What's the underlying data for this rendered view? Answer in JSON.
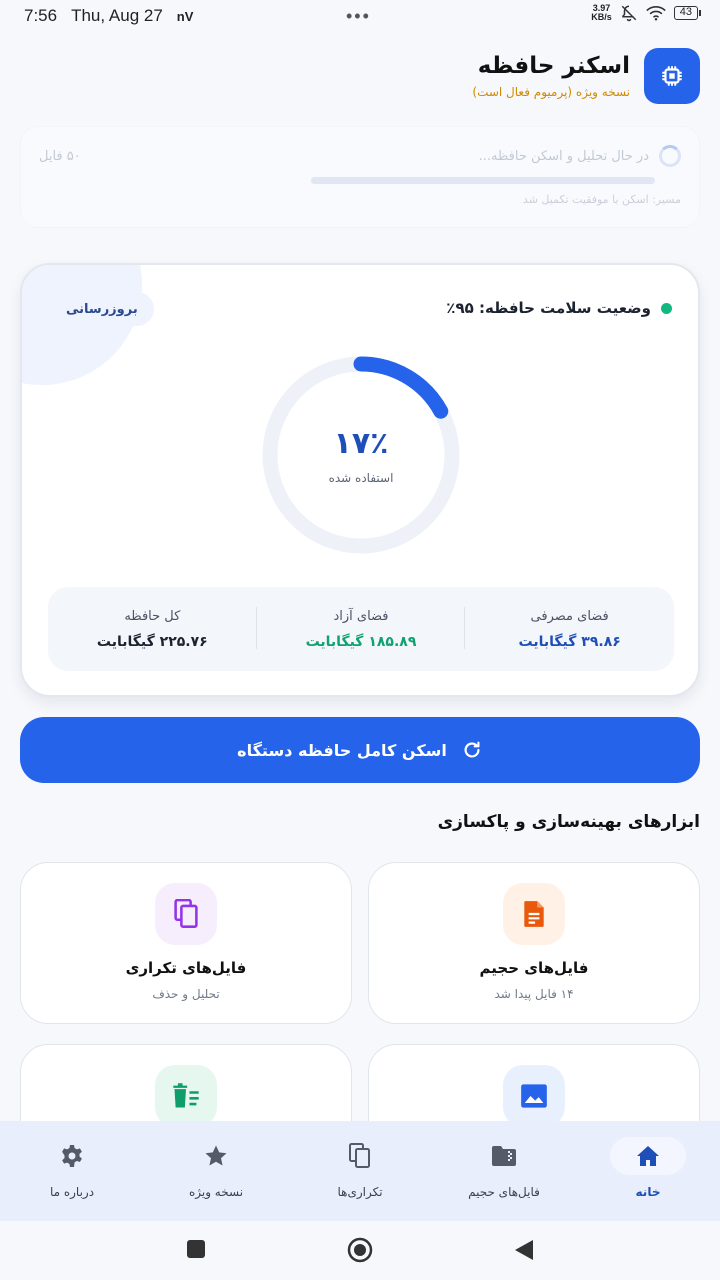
{
  "status_bar": {
    "time": "7:56",
    "date": "Thu, Aug 27",
    "carrier_badge": "nV",
    "more_dots": "•••",
    "net_speed_value": "3.97",
    "net_speed_unit": "KB/s",
    "battery": "43"
  },
  "header": {
    "title": "اسکنر حافظه",
    "subtitle": "نسخه ویژه (پرمیوم فعال است)"
  },
  "scan_progress": {
    "status": "در حال تحلیل و اسکن حافظه...",
    "count": "۵۰ فایل",
    "path_text": "مسیر: اسکن با موفقیت تکمیل شد"
  },
  "storage": {
    "health_label": "وضعیت سلامت حافظه: ۹۵٪",
    "refresh_label": "بروزرسانی",
    "used_percent_text": "۱۷٪",
    "used_fraction": 0.17,
    "used_caption": "استفاده شده",
    "stats": [
      {
        "label": "فضای مصرفی",
        "value": "۳۹.۸۶ گیگابایت"
      },
      {
        "label": "فضای آزاد",
        "value": "۱۸۵.۸۹ گیگابایت"
      },
      {
        "label": "کل حافظه",
        "value": "۲۲۵.۷۶ گیگابایت"
      }
    ]
  },
  "scan_button": {
    "label": "اسکن کامل حافظه دستگاه"
  },
  "tools_section": {
    "title": "ابزارهای بهینه‌سازی و پاکسازی",
    "cards": [
      {
        "title": "فایل‌های حجیم",
        "subtitle": "۱۴ فایل پیدا شد",
        "icon": "document-icon"
      },
      {
        "title": "فایل‌های تکراری",
        "subtitle": "تحلیل و حذف",
        "icon": "copy-icon"
      },
      {
        "title": "",
        "subtitle": "",
        "icon": "image-icon"
      },
      {
        "title": "",
        "subtitle": "",
        "icon": "trash-list-icon"
      }
    ]
  },
  "bottom_nav": [
    {
      "label": "خانه",
      "icon": "home-icon",
      "active": true
    },
    {
      "label": "فایل‌های حجیم",
      "icon": "folder-zip-icon"
    },
    {
      "label": "تکراری‌ها",
      "icon": "copy-icon"
    },
    {
      "label": "نسخه ویژه",
      "icon": "star-icon"
    },
    {
      "label": "درباره ما",
      "icon": "gear-icon"
    }
  ],
  "colors": {
    "primary": "#2563eb",
    "health_dot": "#10b981",
    "free_value": "#10a36f",
    "subtitle_accent": "#d18a00",
    "large_files_tint": "#fff1e6",
    "large_files_icon": "#ea580c",
    "duplicates_tint": "#f6eefd",
    "duplicates_icon": "#9333ea"
  }
}
